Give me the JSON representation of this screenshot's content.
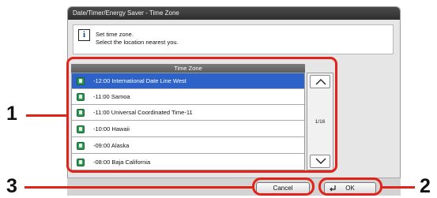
{
  "window": {
    "title": "Date/Timer/Energy Saver - Time Zone"
  },
  "message": {
    "icon": "info-icon",
    "line1": "Set time zone.",
    "line2": "Select the location nearest you."
  },
  "list": {
    "header": "Time Zone",
    "items": [
      {
        "label": "-12:00 International Date Line West",
        "selected": true
      },
      {
        "label": "-11:00 Samoa",
        "selected": false
      },
      {
        "label": "-11:00 Universal Coordinated Time-11",
        "selected": false
      },
      {
        "label": "-10:00 Hawaii",
        "selected": false
      },
      {
        "label": "-09:00 Alaska",
        "selected": false
      },
      {
        "label": "-08:00 Baja California",
        "selected": false
      }
    ],
    "page_indicator": "1/16"
  },
  "buttons": {
    "cancel": "Cancel",
    "ok": "OK"
  },
  "callouts": {
    "one": "1",
    "two": "2",
    "three": "3"
  },
  "colors": {
    "callout": "#e2231a",
    "selection": "#2d63c8",
    "titlebar": "#3a3a3a"
  }
}
